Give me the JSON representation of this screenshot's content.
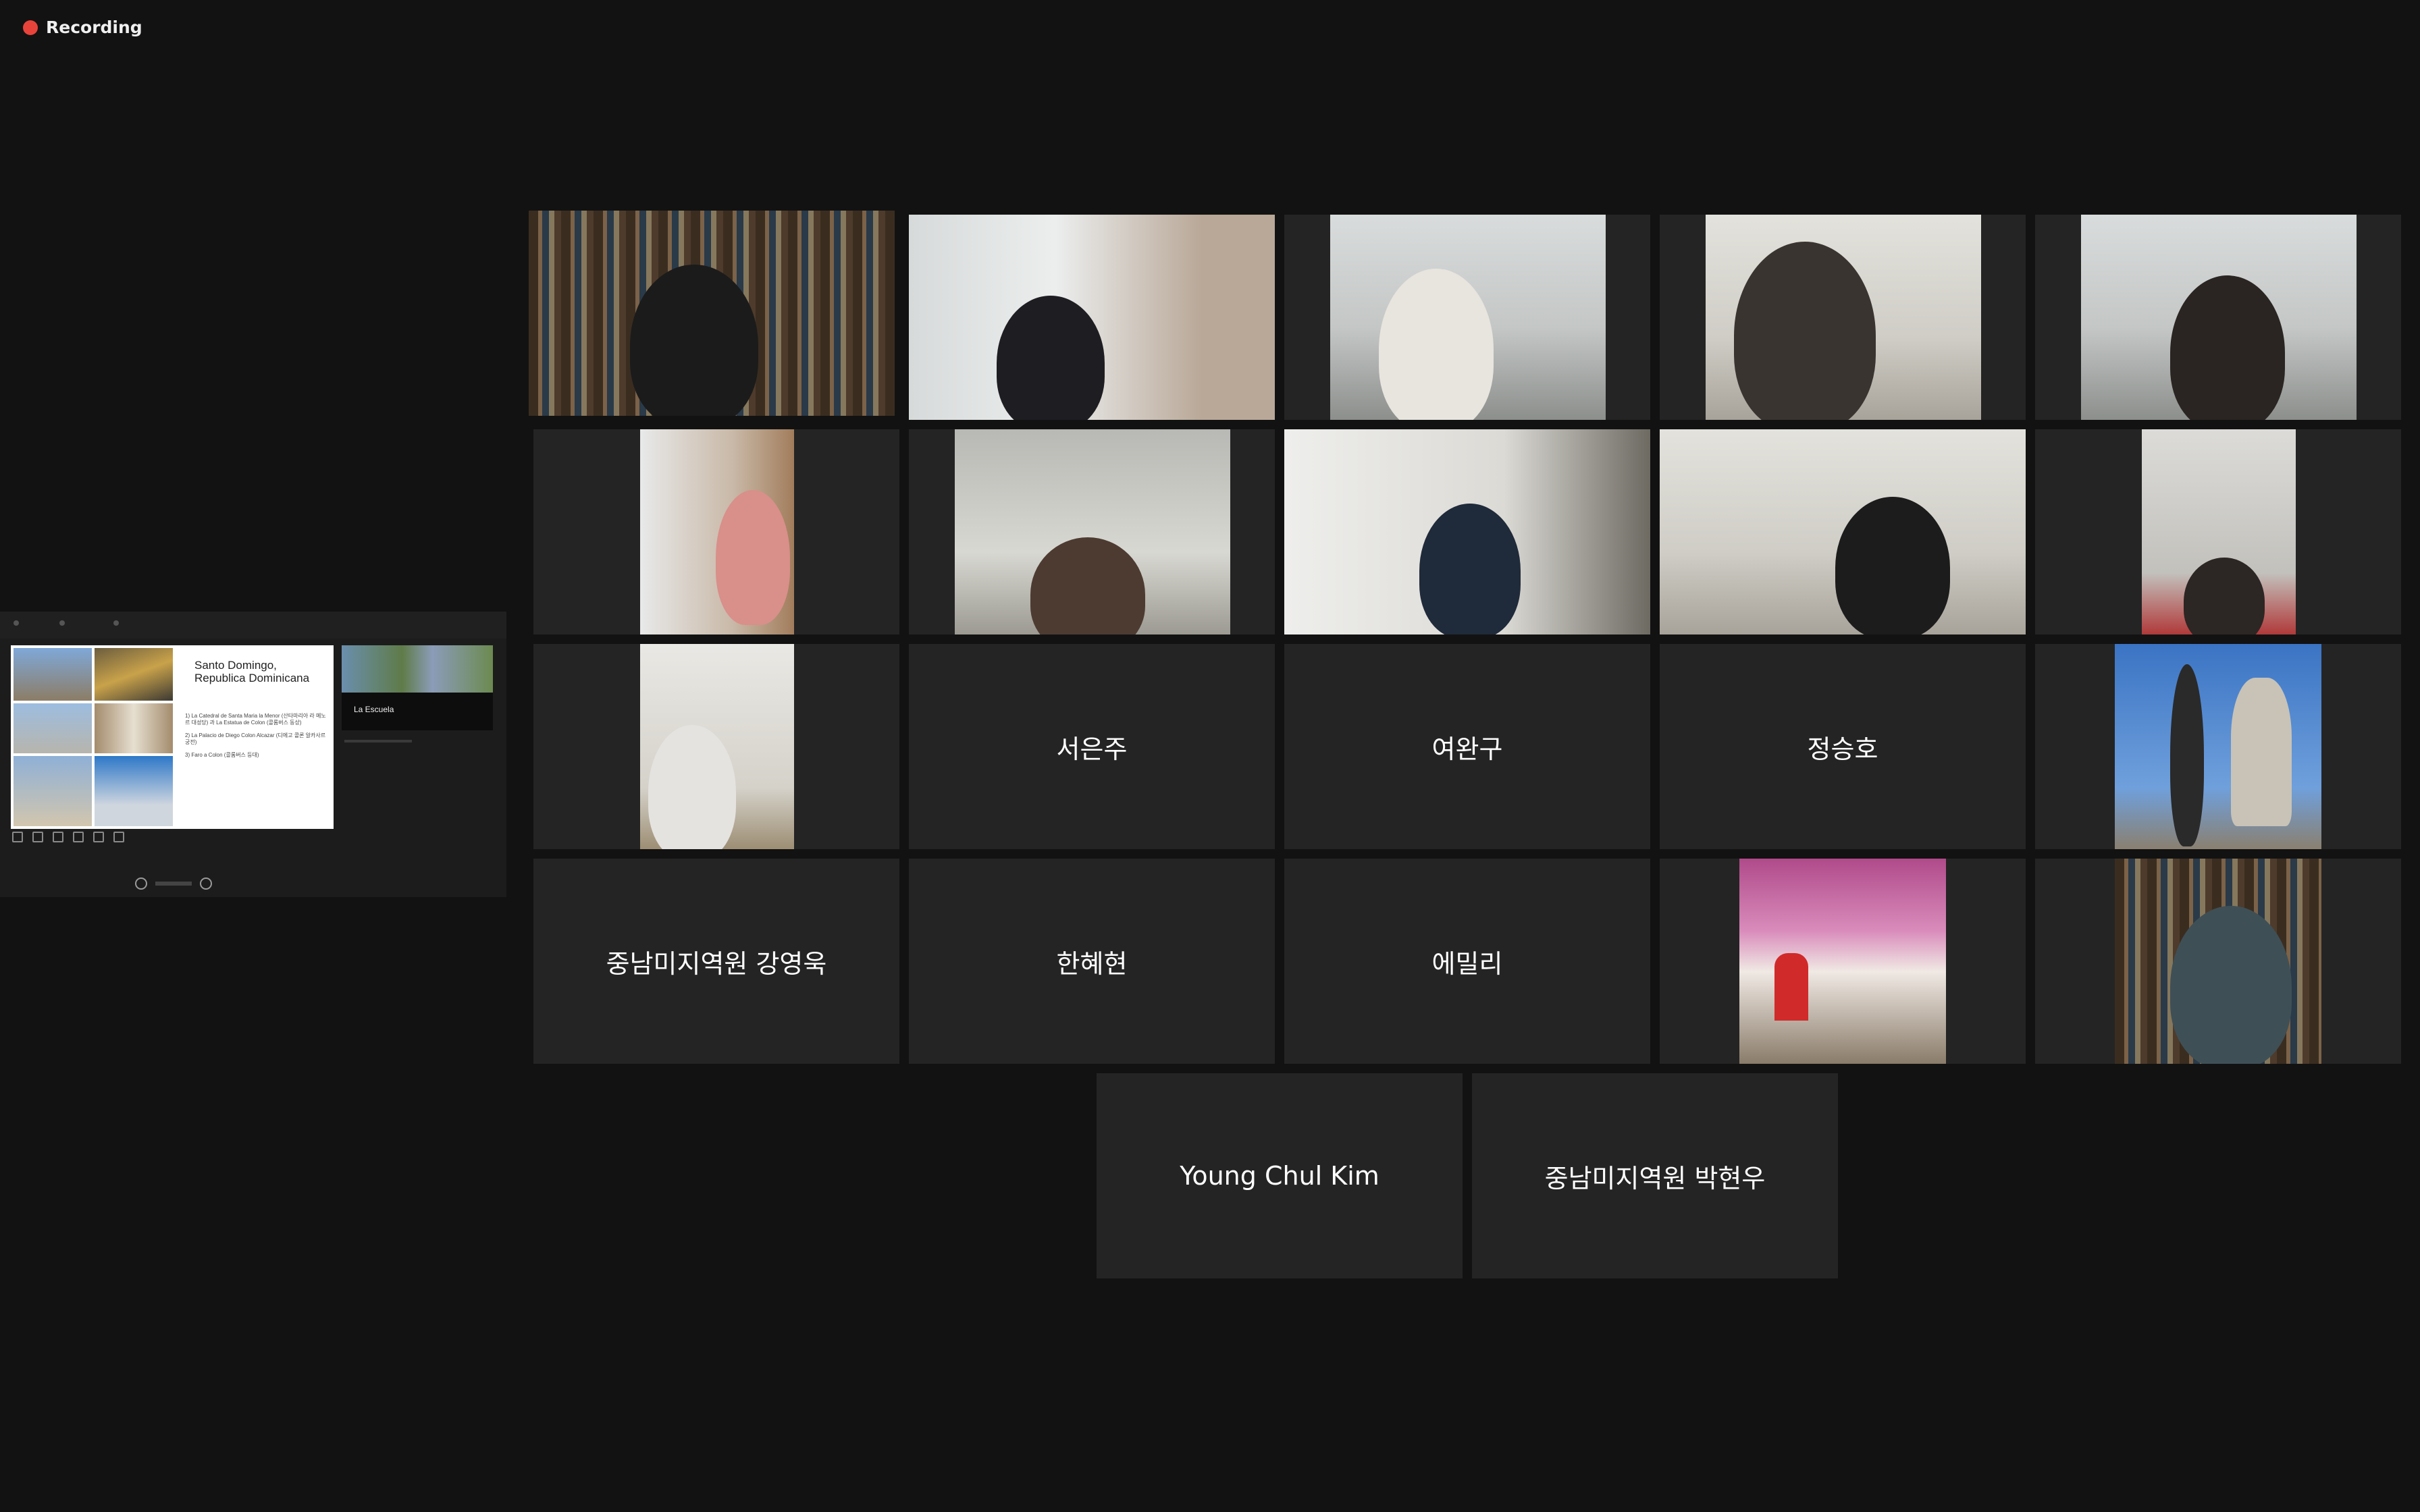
{
  "recording": {
    "label": "Recording",
    "color": "#e8433b"
  },
  "presentation": {
    "slide_title": "Santo Domingo, Republica Dominicana",
    "bullets": [
      "1) La Catedral de Santa Maria la Menor (산타마리아 라 메노르 대성당) 과 La Estatua de Colon (콜롬버스 동상)",
      "2) La Palacio de Diego Colon Alcazar (디에고 콜론 알카사르 궁전)",
      "3) Faro a Colon (콜롬버스 등대)"
    ],
    "next_slide_label": "La Escuela"
  },
  "participants": [
    {
      "name": "",
      "video": true,
      "active": true
    },
    {
      "name": "",
      "video": true
    },
    {
      "name": "",
      "video": true
    },
    {
      "name": "",
      "video": true
    },
    {
      "name": "",
      "video": true
    },
    {
      "name": "",
      "video": true
    },
    {
      "name": "",
      "video": true
    },
    {
      "name": "",
      "video": true
    },
    {
      "name": "",
      "video": true
    },
    {
      "name": "",
      "video": true
    },
    {
      "name": "",
      "video": true
    },
    {
      "name": "서은주",
      "video": false
    },
    {
      "name": "여완구",
      "video": false
    },
    {
      "name": "정승호",
      "video": false
    },
    {
      "name": "",
      "video": true
    },
    {
      "name": "중남미지역원 강영욱",
      "video": false
    },
    {
      "name": "한혜현",
      "video": false
    },
    {
      "name": "에밀리",
      "video": false
    },
    {
      "name": "",
      "video": true
    },
    {
      "name": "",
      "video": true
    },
    {
      "name": "Young Chul Kim",
      "video": false
    },
    {
      "name": "중남미지역원 박현우",
      "video": false
    }
  ],
  "colors": {
    "background": "#121212",
    "tile": "#242424",
    "active_border": "#e6e685"
  }
}
